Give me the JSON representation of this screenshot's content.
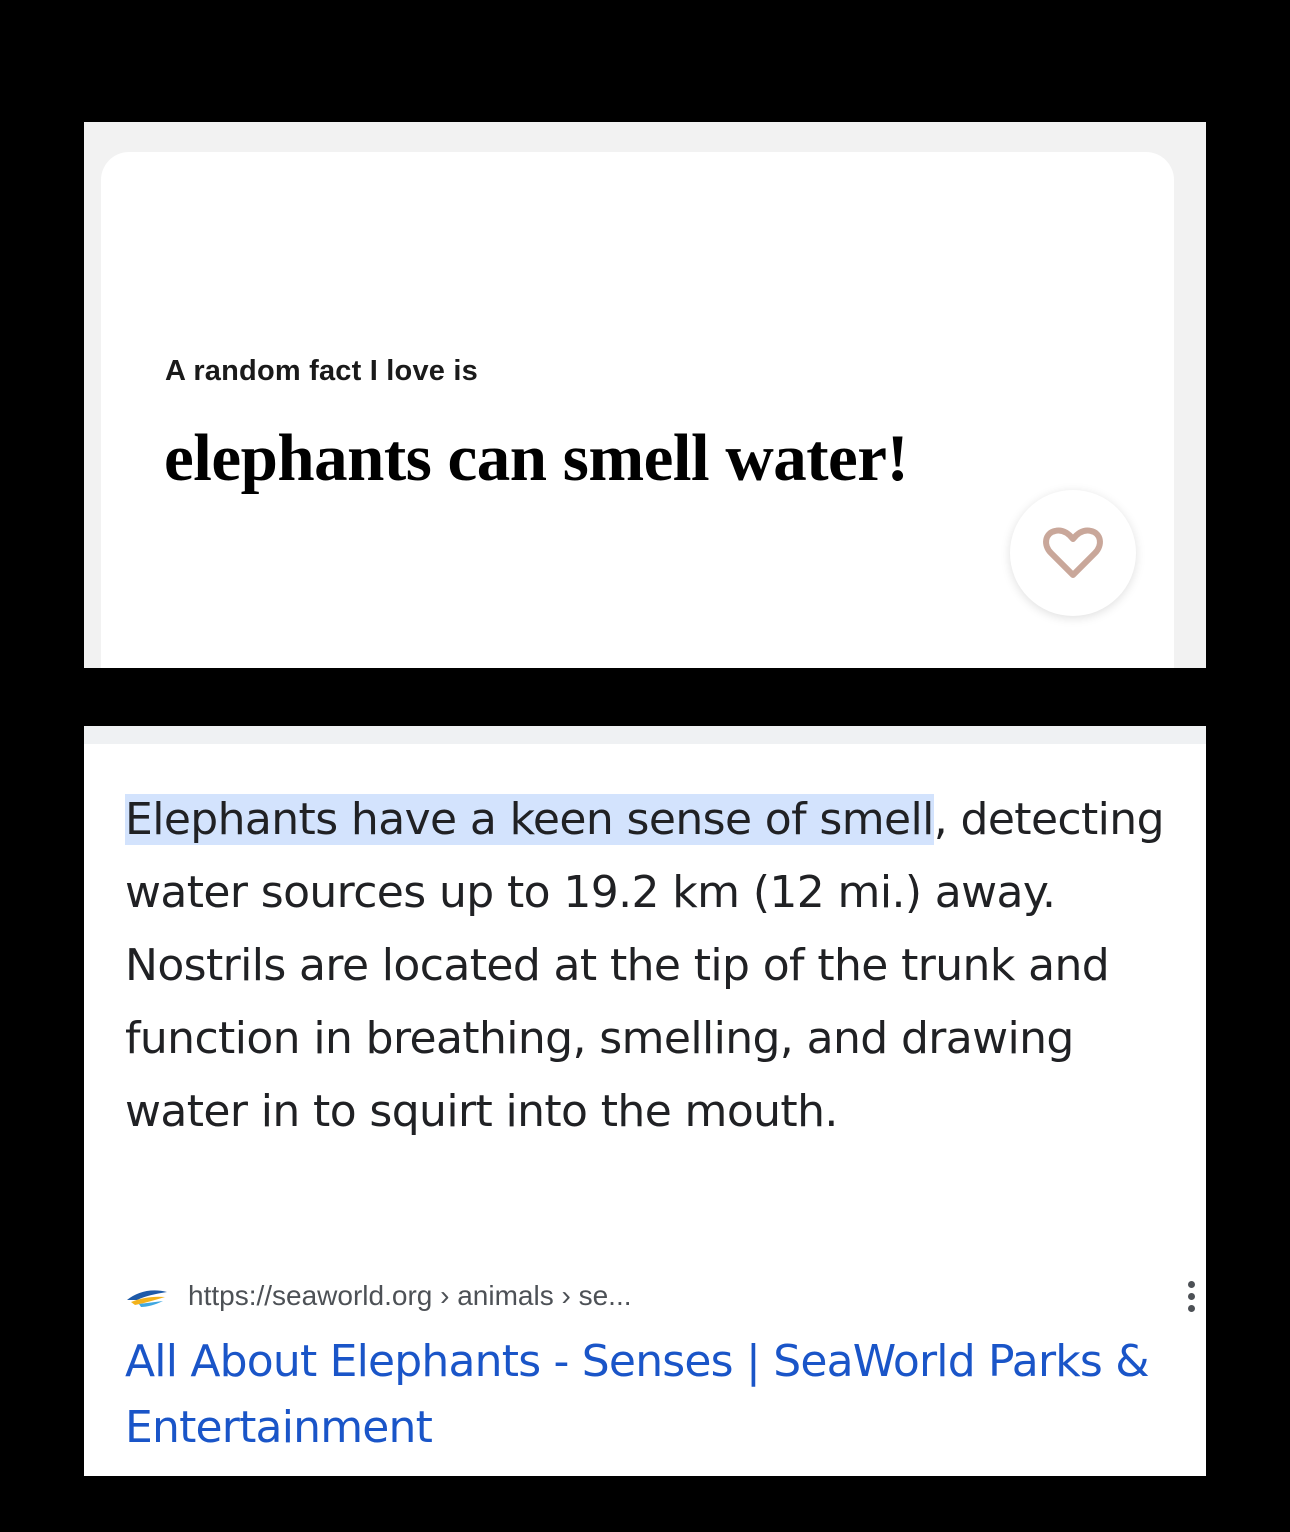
{
  "prompt_card": {
    "question": "A random fact I love is",
    "answer": "elephants can smell water!",
    "like_icon": "heart-outline-icon",
    "accent_color": "#c9a79a"
  },
  "search_result": {
    "snippet_highlight": "Elephants have a keen sense of smell",
    "snippet_rest": ", detecting water sources up to 19.2 km (12 mi.) away. Nostrils are located at the tip of the trunk and function in breathing, smelling, and drawing water in to squirt into the mouth.",
    "source_icon": "seaworld-favicon-icon",
    "source_url": "https://seaworld.org › animals › se...",
    "more_icon": "more-vert-icon",
    "title": "All About Elephants - Senses | SeaWorld Parks & Entertainment",
    "link_color": "#1a55c8",
    "highlight_color": "#d3e3fd"
  }
}
